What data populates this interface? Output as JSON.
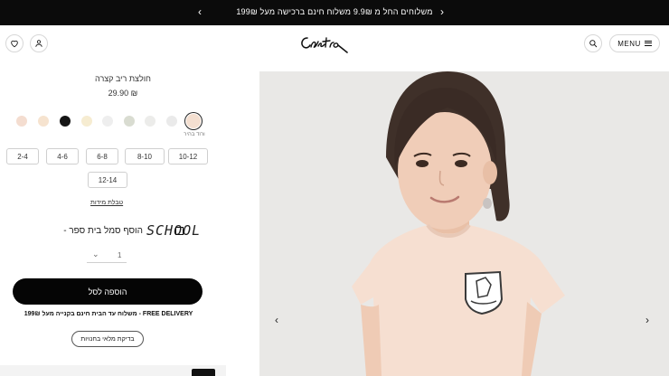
{
  "announcement": {
    "message": "משלוחים החל מ 9.9₪ משלוח חינם ברכישה מעל 199₪",
    "prev_icon": "chevron-left-icon",
    "next_icon": "chevron-right-icon"
  },
  "header": {
    "menu_label": "MENU",
    "logo_text": "Castro",
    "wishlist_icon": "heart-icon",
    "account_icon": "user-icon",
    "search_icon": "search-icon"
  },
  "product": {
    "title": "חולצת ריב קצרה",
    "price": "29.90 ₪",
    "selected_color_name": "ורוד בהיר",
    "colors": [
      "#f4ddd0",
      "#f6e3cf",
      "#151515",
      "#f6ecd1",
      "#eeeeee",
      "#d9dcd1",
      "#ececea",
      "#eaeaea",
      "#f4dfd0"
    ],
    "sizes": [
      "10-12",
      "8-10",
      "6-8",
      "4-6",
      "2-4",
      "12-14"
    ],
    "size_table_label": "טבלת מידות",
    "school_option_text": "- הוסף סמל בית ספר",
    "school_logo_text": "SCHOOL",
    "quantity": "1",
    "add_to_cart_label": "הוספה לסל",
    "delivery_text": "משלוח עד הבית חינם בקנייה מעל 199₪ - FREE DELIVERY",
    "availability_button_label": "בדיקת מלאי בחנויות"
  },
  "gallery": {
    "prev_icon": "chevron-left-icon",
    "next_icon": "chevron-right-icon"
  },
  "colors": {
    "topbar_bg": "#0b0b0b",
    "button_bg": "#050505",
    "image_bg": "#e9e8e6"
  }
}
